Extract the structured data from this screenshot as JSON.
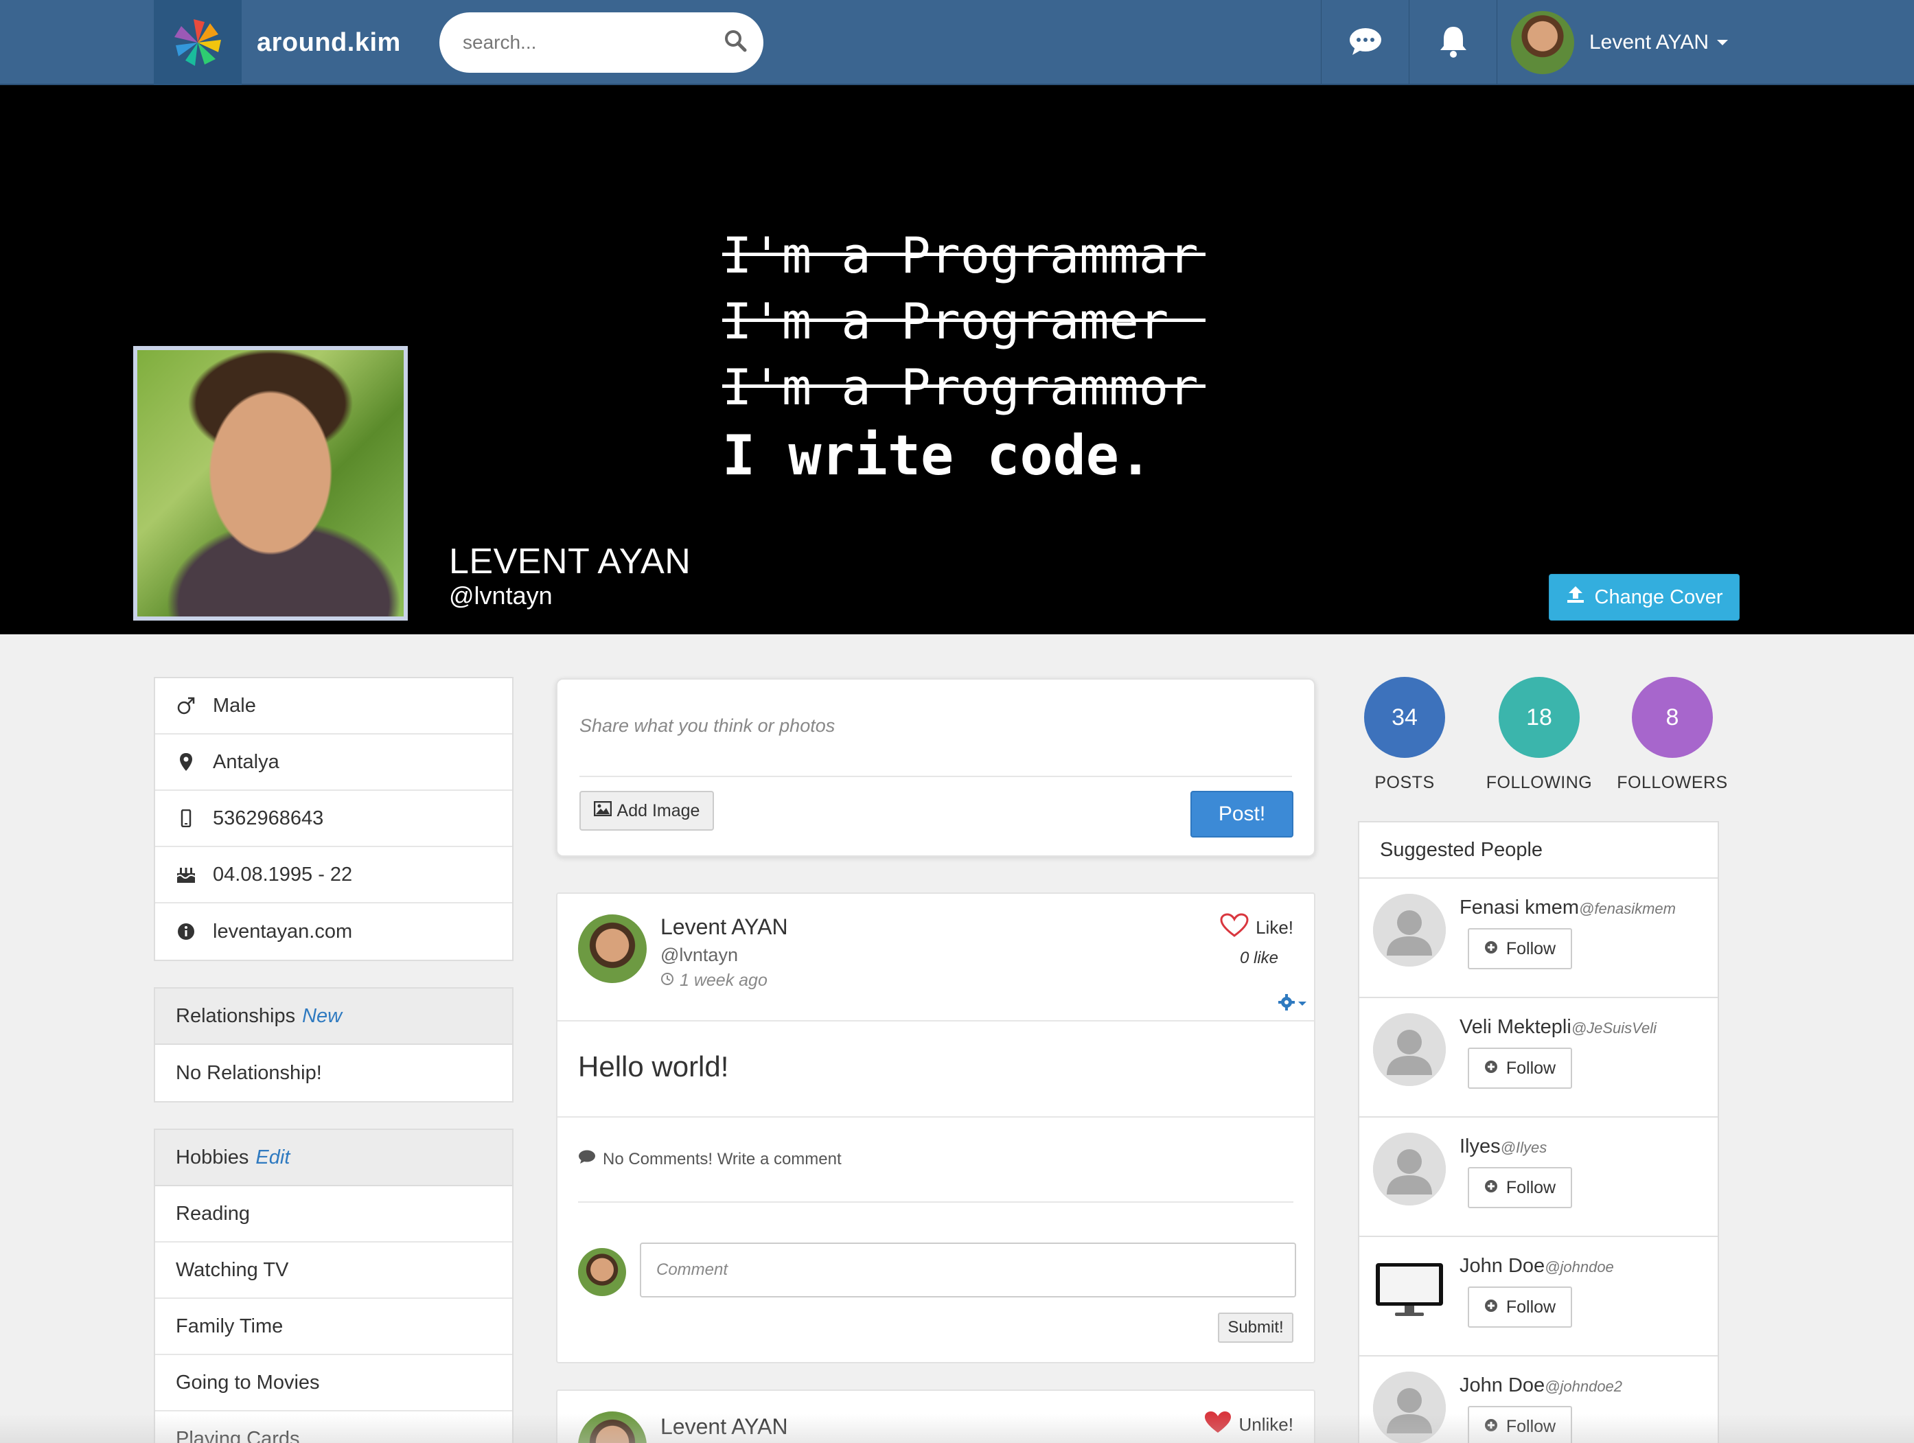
{
  "navbar": {
    "brand": "around.kim",
    "search_placeholder": "search...",
    "user_name": "Levent AYAN"
  },
  "cover": {
    "lines": [
      "I'm a Programmar",
      "I'm a Programer",
      "I'm a Programmor",
      "I write code."
    ],
    "profile_name": "LEVENT AYAN",
    "profile_handle": "@lvntayn",
    "change_cover_label": "Change Cover"
  },
  "about": {
    "gender": "Male",
    "location": "Antalya",
    "phone": "5362968643",
    "birthday": "04.08.1995 - 22",
    "website": "leventayan.com"
  },
  "relationships": {
    "title": "Relationships",
    "accent": "New",
    "status": "No Relationship!"
  },
  "hobbies": {
    "title": "Hobbies",
    "accent": "Edit",
    "items": [
      "Reading",
      "Watching TV",
      "Family Time",
      "Going to Movies",
      "Playing Cards"
    ]
  },
  "composer": {
    "placeholder": "Share what you think or photos",
    "add_image_label": "Add Image",
    "post_label": "Post!"
  },
  "post1": {
    "author": "Levent AYAN",
    "handle": "@lvntayn",
    "time": "1 week ago",
    "like_label": "Like!",
    "like_count": "0 like",
    "body": "Hello world!",
    "comments_status": "No Comments! Write a comment",
    "comment_placeholder": "Comment",
    "submit_label": "Submit!"
  },
  "post2": {
    "author": "Levent AYAN",
    "unlike_label": "Unlike!"
  },
  "stats": {
    "posts": "34",
    "posts_label": "POSTS",
    "following": "18",
    "following_label": "FOLLOWING",
    "followers": "8",
    "followers_label": "FOLLOWERS"
  },
  "suggested": {
    "title": "Suggested People",
    "follow_label": "Follow",
    "people": [
      {
        "name": "Fenasi kmem",
        "handle": "@fenasikmem"
      },
      {
        "name": "Veli Mektepli",
        "handle": "@JeSuisVeli"
      },
      {
        "name": "Ilyes",
        "handle": "@Ilyes"
      },
      {
        "name": "John Doe",
        "handle": "@johndoe"
      },
      {
        "name": "John Doe",
        "handle": "@johndoe2"
      }
    ]
  },
  "colors": {
    "navbar": "#3b6590",
    "posts_circle": "#3d72bc",
    "following_circle": "#3bb5ac",
    "followers_circle": "#a766cc",
    "change_cover": "#33aede",
    "post_button": "#3c8ad6",
    "like_heart": "#d9363e"
  }
}
